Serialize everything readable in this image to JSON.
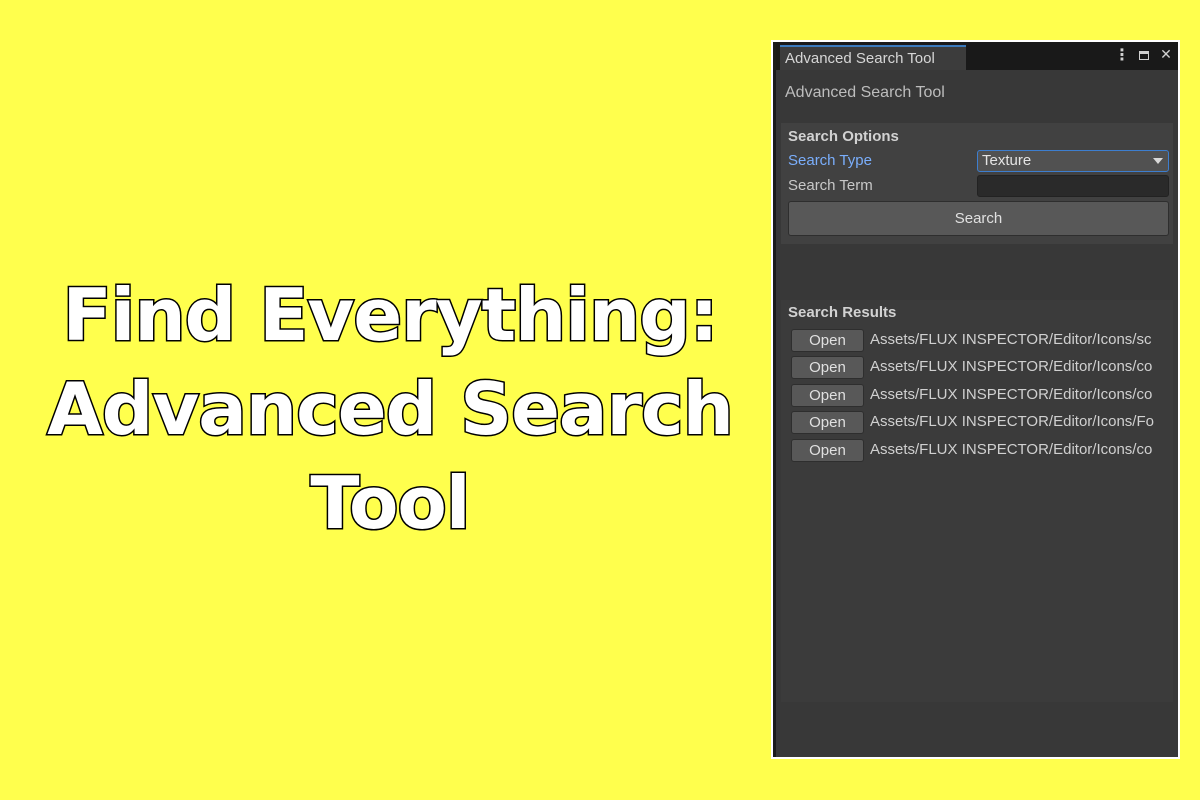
{
  "banner": {
    "background_color": "#ffff4d",
    "headline_lines": [
      "Find Everything:",
      "Advanced Search",
      "Tool"
    ]
  },
  "window": {
    "tab_title": "Advanced Search Tool",
    "header_title": "Advanced Search Tool",
    "controls": {
      "kebab_icon": "kebab-menu-icon",
      "maximize_icon": "maximize-icon",
      "close_icon": "close-icon"
    },
    "accent_color": "#3a79bb"
  },
  "search_options": {
    "header": "Search Options",
    "search_type_label": "Search Type",
    "search_type_value": "Texture",
    "search_term_label": "Search Term",
    "search_term_value": "",
    "search_button_label": "Search"
  },
  "search_results": {
    "header": "Search Results",
    "open_label": "Open",
    "items": [
      "Assets/FLUX INSPECTOR/Editor/Icons/sc",
      "Assets/FLUX INSPECTOR/Editor/Icons/co",
      "Assets/FLUX INSPECTOR/Editor/Icons/co",
      "Assets/FLUX INSPECTOR/Editor/Icons/Fo",
      "Assets/FLUX INSPECTOR/Editor/Icons/co"
    ]
  }
}
